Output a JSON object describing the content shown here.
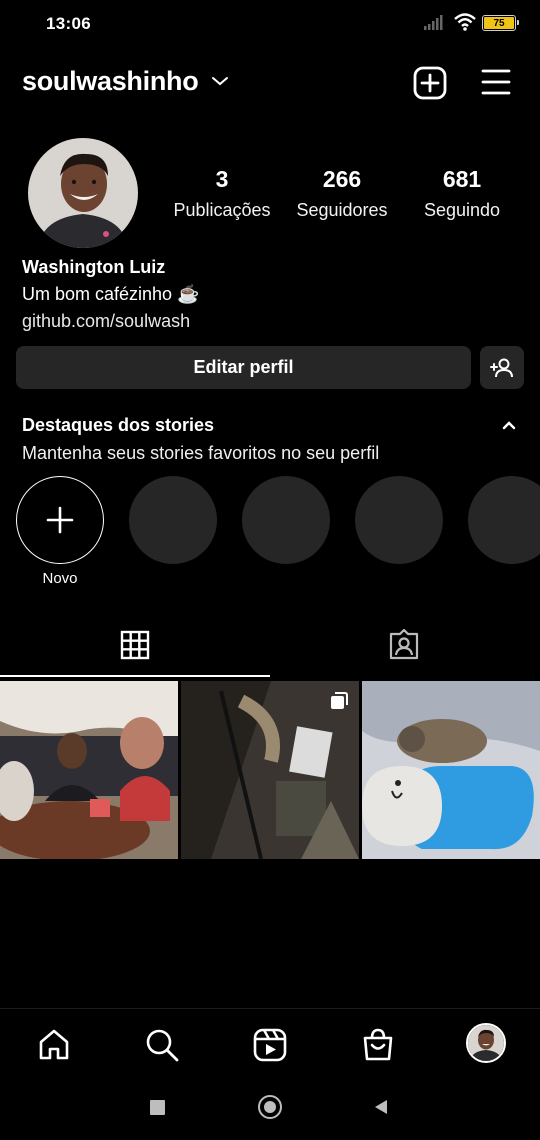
{
  "status_bar": {
    "time": "13:06",
    "battery": "75"
  },
  "header": {
    "username": "soulwashinho",
    "icons": [
      "chevron-down-icon",
      "add-post-icon",
      "menu-icon"
    ]
  },
  "profile": {
    "stats": [
      {
        "value": "3",
        "label": "Publicações"
      },
      {
        "value": "266",
        "label": "Seguidores"
      },
      {
        "value": "681",
        "label": "Seguindo"
      }
    ],
    "name": "Washington Luiz",
    "bio": "Um bom cafézinho ☕",
    "link": "github.com/soulwash"
  },
  "buttons": {
    "edit_profile": "Editar perfil"
  },
  "highlights": {
    "title": "Destaques dos stories",
    "subtitle": "Mantenha seus stories favoritos no seu perfil",
    "new_label": "Novo"
  },
  "tabs": [
    "grid-icon",
    "tagged-icon"
  ],
  "bottom_nav": [
    "home-icon",
    "search-icon",
    "reels-icon",
    "shop-icon",
    "profile-avatar"
  ],
  "colors": {
    "battery": "#f0c417",
    "surface": "#262626",
    "background": "#000000"
  }
}
